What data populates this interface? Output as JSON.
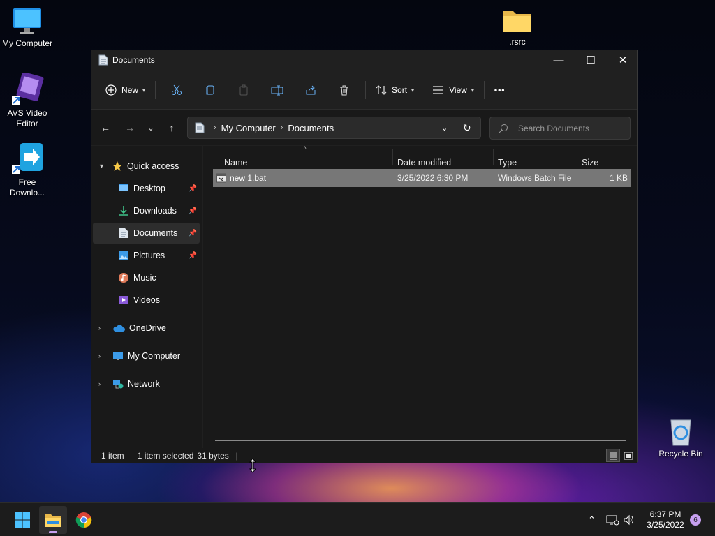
{
  "desktop": {
    "icons": [
      {
        "label": "My Computer"
      },
      {
        "label": "AVS Video Editor"
      },
      {
        "label": "Free Downlo..."
      },
      {
        "label": ".rsrc"
      },
      {
        "label": "Recycle Bin"
      }
    ]
  },
  "window": {
    "title": "Documents",
    "controls": {
      "minimize": "—",
      "maximize": "☐",
      "close": "✕"
    }
  },
  "toolbar": {
    "new_label": "New",
    "sort_label": "Sort",
    "view_label": "View",
    "more_label": "•••"
  },
  "address": {
    "crumbs": [
      "My Computer",
      "Documents"
    ],
    "search_placeholder": "Search Documents"
  },
  "sidebar": {
    "quick_access": "Quick access",
    "items": [
      {
        "label": "Desktop",
        "pinned": true
      },
      {
        "label": "Downloads",
        "pinned": true
      },
      {
        "label": "Documents",
        "pinned": true,
        "selected": true
      },
      {
        "label": "Pictures",
        "pinned": true
      },
      {
        "label": "Music",
        "pinned": false
      },
      {
        "label": "Videos",
        "pinned": false
      }
    ],
    "roots": [
      {
        "label": "OneDrive"
      },
      {
        "label": "My Computer"
      },
      {
        "label": "Network"
      }
    ]
  },
  "files": {
    "columns": [
      "Name",
      "Date modified",
      "Type",
      "Size"
    ],
    "rows": [
      {
        "name": "new 1.bat",
        "date": "3/25/2022 6:30 PM",
        "type": "Windows Batch File",
        "size": "1 KB",
        "selected": true
      }
    ]
  },
  "status": {
    "count": "1 item",
    "selection": "1 item selected",
    "size": "31 bytes",
    "trailing": "|"
  },
  "taskbar": {
    "time": "6:37 PM",
    "date": "3/25/2022",
    "notification_count": "6",
    "accent": "#4cc2ff"
  }
}
